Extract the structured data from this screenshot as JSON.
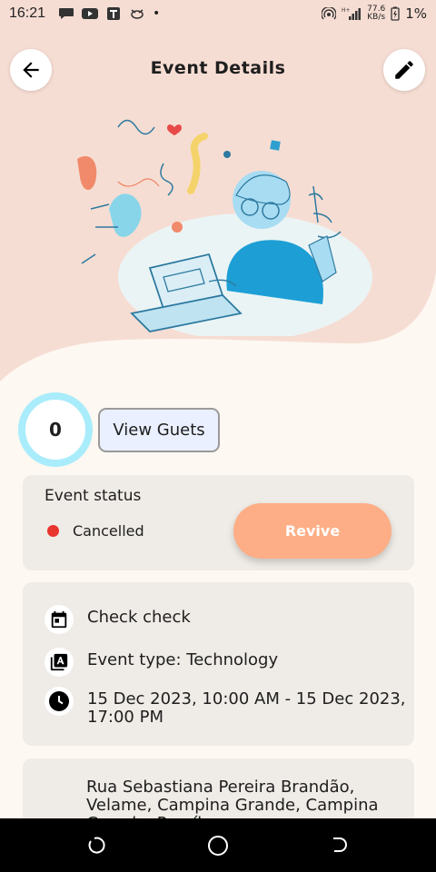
{
  "status_bar": {
    "time": "16:21",
    "net_speed_value": "77.6",
    "net_speed_unit": "KB/s",
    "battery": "1%"
  },
  "header": {
    "title": "Event Details"
  },
  "guests": {
    "count": "0",
    "view_label": "View Guets"
  },
  "status_card": {
    "title": "Event status",
    "status": "Cancelled",
    "status_color": "#e8352e",
    "revive_label": "Revive"
  },
  "info": {
    "name": "Check check",
    "type": "Event type: Technology",
    "datetime": "15 Dec 2023, 10:00 AM - 15 Dec 2023, 17:00 PM"
  },
  "address": {
    "text": "Rua Sebastiana Pereira Brandão, Velame, Campina Grande, Campina Grande, Paraíba"
  },
  "colors": {
    "peach": "#f6ddd3",
    "cream": "#fdf8f2",
    "accent": "#fdae86",
    "ring": "#a9ecfb"
  }
}
